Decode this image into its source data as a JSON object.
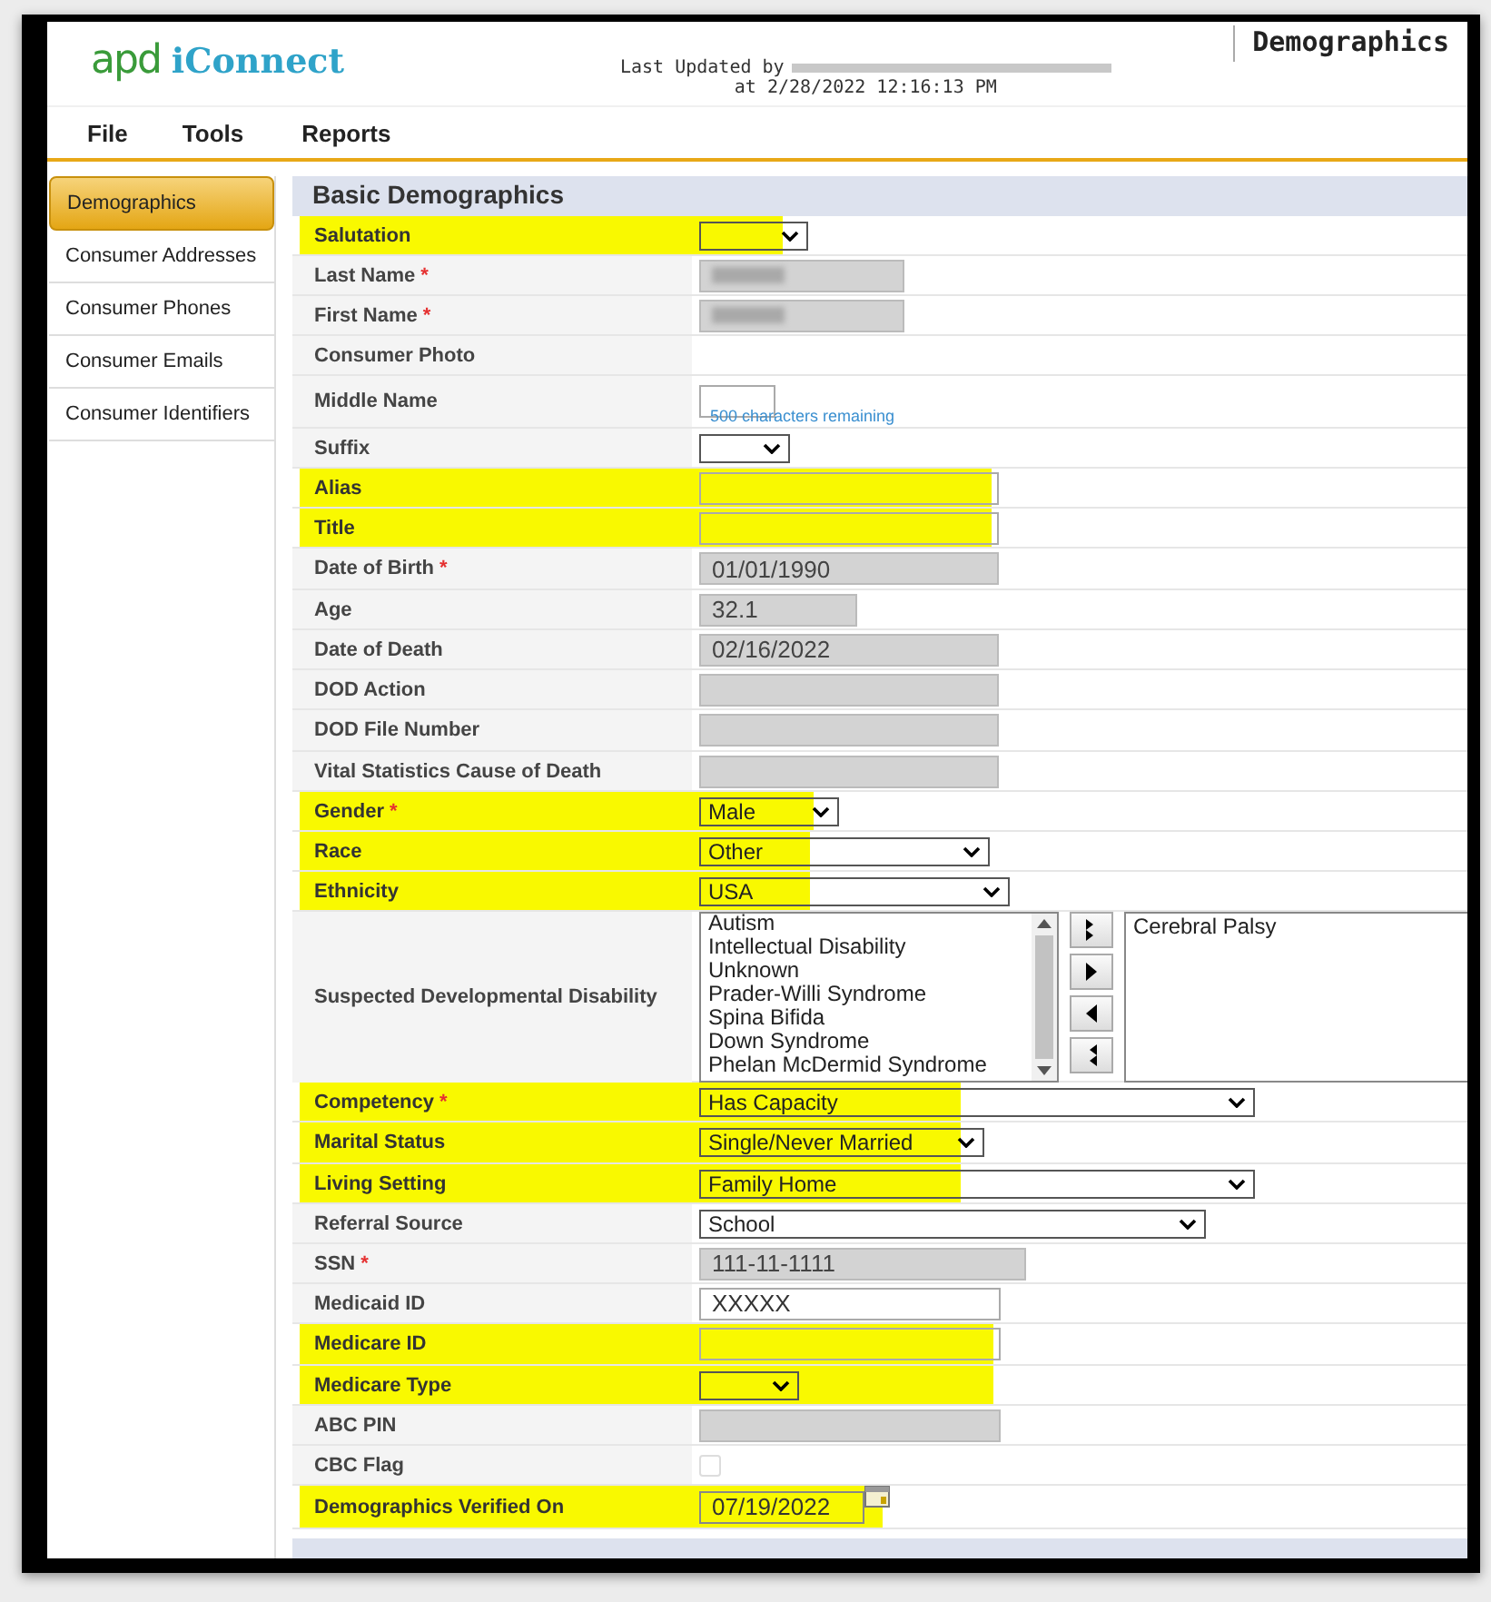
{
  "header": {
    "logo_prefix": "apd",
    "logo_name": "iConnect",
    "last_updated_label": "Last Updated by",
    "last_updated_at": "at 2/28/2022 12:16:13 PM",
    "page_title": "Demographics"
  },
  "menu": [
    "File",
    "Tools",
    "Reports"
  ],
  "sidebar": {
    "items": [
      {
        "label": "Demographics",
        "selected": true
      },
      {
        "label": "Consumer Addresses",
        "selected": false
      },
      {
        "label": "Consumer Phones",
        "selected": false
      },
      {
        "label": "Consumer Emails",
        "selected": false
      },
      {
        "label": "Consumer Identifiers",
        "selected": false
      }
    ]
  },
  "section": {
    "title": "Basic Demographics"
  },
  "fields": [
    {
      "label": "Salutation",
      "kind": "select",
      "highlighted": true
    },
    {
      "label": "Last Name",
      "required_mark": "*",
      "kind": "readonly",
      "redacted": true,
      "highlighted": false
    },
    {
      "label": "First Name",
      "required_mark": "*",
      "kind": "readonly",
      "redacted": true,
      "highlighted": false
    },
    {
      "label": "Consumer Photo",
      "kind": "blank",
      "highlighted": false
    },
    {
      "label": "Middle Name",
      "kind": "input",
      "hint": "500 characters remaining",
      "highlighted": false
    },
    {
      "label": "Suffix",
      "kind": "select",
      "highlighted": false
    },
    {
      "label": "Alias",
      "kind": "input",
      "highlighted": true
    },
    {
      "label": "Title",
      "kind": "input",
      "highlighted": true
    },
    {
      "label": "Date of Birth",
      "required_mark": "*",
      "kind": "readonly",
      "value": "01/01/1990",
      "highlighted": false
    },
    {
      "label": "Age",
      "kind": "readonly",
      "value": "32.1",
      "highlighted": false
    },
    {
      "label": "Date of Death",
      "kind": "readonly",
      "value": "02/16/2022",
      "highlighted": false
    },
    {
      "label": "DOD Action",
      "kind": "readonly",
      "highlighted": false
    },
    {
      "label": "DOD File Number",
      "kind": "readonly",
      "highlighted": false
    },
    {
      "label": "Vital Statistics Cause of Death",
      "kind": "readonly",
      "highlighted": false
    },
    {
      "label": "Gender",
      "required_mark": "*",
      "kind": "select",
      "value": "Male",
      "highlighted": true
    },
    {
      "label": "Race",
      "kind": "select",
      "value": "Other",
      "highlighted": true
    },
    {
      "label": "Ethnicity",
      "kind": "select",
      "value": "USA",
      "highlighted": true
    },
    {
      "label": "Suspected Developmental Disability",
      "kind": "listbox",
      "highlighted": false,
      "options": [
        "Autism",
        "Intellectual Disability",
        "Unknown",
        "Prader-Willi Syndrome",
        "Spina Bifida",
        "Down Syndrome",
        "Phelan McDermid Syndrome"
      ],
      "chosen": [
        "Cerebral Palsy"
      ]
    },
    {
      "label": "Competency",
      "required_mark": "*",
      "kind": "select",
      "value": "Has Capacity",
      "highlighted": true
    },
    {
      "label": "Marital Status",
      "kind": "select",
      "value": "Single/Never Married",
      "highlighted": true
    },
    {
      "label": "Living Setting",
      "kind": "select",
      "value": "Family Home",
      "highlighted": true
    },
    {
      "label": "Referral Source",
      "kind": "select",
      "value": "School",
      "highlighted": false
    },
    {
      "label": "SSN",
      "required_mark": "*",
      "kind": "readonly",
      "value": "111-11-1111",
      "highlighted": false
    },
    {
      "label": "Medicaid ID",
      "kind": "input",
      "value": "XXXXX",
      "highlighted": false
    },
    {
      "label": "Medicare ID",
      "kind": "input",
      "highlighted": true
    },
    {
      "label": "Medicare Type",
      "kind": "select",
      "highlighted": true
    },
    {
      "label": "ABC PIN",
      "kind": "readonly",
      "highlighted": false
    },
    {
      "label": "CBC Flag",
      "kind": "checkbox",
      "checked": false,
      "disabled": true,
      "highlighted": false
    },
    {
      "label": "Demographics Verified On",
      "kind": "date",
      "value": "07/19/2022",
      "highlighted": true
    }
  ]
}
